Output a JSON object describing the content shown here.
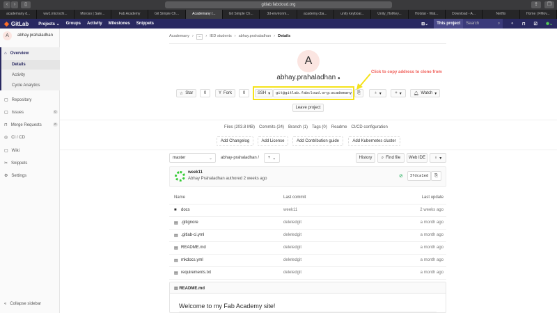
{
  "browser": {
    "url": "gitlab.fabcloud.org",
    "tabs": [
      "academany d...",
      "ww1.microchi...",
      "Moroso | Sale...",
      "Fab Academy",
      "Git Simple Ch...",
      "Academany /...",
      "Git Simple Ch...",
      "3d-environm...",
      "academy.cba...",
      "unity keyboar...",
      "Unity_HotKey...",
      "Hotstar - Wat...",
      "Download - A...",
      "Netflix",
      "Home | FMov..."
    ],
    "active_tab": 5
  },
  "nav": {
    "brand": "GitLab",
    "items": [
      "Projects ⌄",
      "Groups",
      "Activity",
      "Milestones",
      "Snippets"
    ],
    "scope": "This project",
    "search_placeholder": "Search"
  },
  "sidebar": {
    "avatar": "A",
    "project": "abhay.prahaladhan",
    "overview": "Overview",
    "sub": [
      "Details",
      "Activity",
      "Cycle Analytics"
    ],
    "items": [
      {
        "label": "Repository"
      },
      {
        "label": "Issues",
        "count": "0"
      },
      {
        "label": "Merge Requests",
        "count": "0"
      },
      {
        "label": "CI / CD"
      },
      {
        "label": "Wiki"
      },
      {
        "label": "Snippets"
      },
      {
        "label": "Settings"
      }
    ],
    "collapse": "Collapse sidebar"
  },
  "breadcrumb": [
    "Academany",
    "···",
    "IED students",
    "abhay.prahaladhan",
    "Details"
  ],
  "project": {
    "avatar": "A",
    "name": "abhay.prahaladhan",
    "star": "Star",
    "star_count": "0",
    "fork": "Fork",
    "fork_count": "0",
    "protocol": "SSH",
    "clone_url": "git@gitlab.fabcloud.org:academany",
    "watch": "Watch",
    "leave": "Leave project"
  },
  "annotation": "Click to copy address to clone from",
  "stats": [
    "Files (203.8 MB)",
    "Commits (24)",
    "Branch (1)",
    "Tags (0)",
    "Readme",
    "CI/CD configuration"
  ],
  "add_buttons": [
    "Add Changelog",
    "Add License",
    "Add Contribution guide",
    "Add Kubernetes cluster"
  ],
  "repo": {
    "branch": "master",
    "path": "abhay-prahaladhan",
    "history": "History",
    "find": "Find file",
    "webide": "Web IDE"
  },
  "commit": {
    "title": "week11",
    "author": "Abhay Prahaladhan authored 2 weeks ago",
    "sha": "3fdca1ed"
  },
  "table": {
    "headers": [
      "Name",
      "Last commit",
      "Last update"
    ],
    "rows": [
      {
        "name": "docs",
        "commit": "week11",
        "update": "2 weeks ago",
        "folder": true
      },
      {
        "name": ".gitignore",
        "commit": "deletedgit",
        "update": "a month ago"
      },
      {
        "name": ".gitlab-ci.yml",
        "commit": "deletedgit",
        "update": "a month ago"
      },
      {
        "name": "README.md",
        "commit": "deletedgit",
        "update": "a month ago"
      },
      {
        "name": "mkdocs.yml",
        "commit": "deletedgit",
        "update": "a month ago"
      },
      {
        "name": "requirements.txt",
        "commit": "deletedgit",
        "update": "a month ago"
      }
    ]
  },
  "readme": {
    "file": "README.md",
    "heading": "Welcome to my Fab Academy site!"
  }
}
